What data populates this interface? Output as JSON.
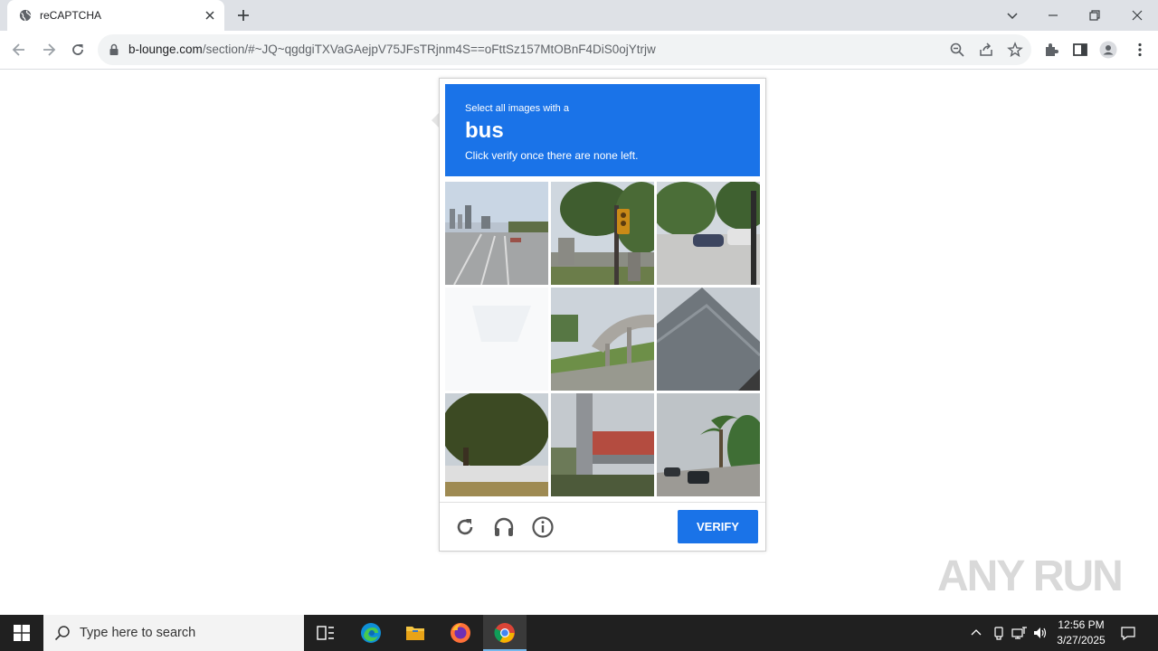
{
  "browser": {
    "tab_title": "reCAPTCHA",
    "url_host": "b-lounge.com",
    "url_path": "/section/#~JQ~qgdgiTXVaGAejpV75JFsTRjnm4S==oFttSz157MtOBnF4DiS0ojYtrjw"
  },
  "captcha": {
    "instruction_line1": "Select all images with a",
    "target": "bus",
    "instruction_line2": "Click verify once there are none left.",
    "verify_label": "VERIFY",
    "accent_color": "#1a73e8",
    "tiles": [
      {
        "name": "tile-highway-skyline",
        "scene": "road-skyline"
      },
      {
        "name": "tile-traffic-light",
        "scene": "traffic-light-trees"
      },
      {
        "name": "tile-parked-cars",
        "scene": "cars-trees"
      },
      {
        "name": "tile-faded-blank",
        "scene": "blank"
      },
      {
        "name": "tile-overpass",
        "scene": "overpass"
      },
      {
        "name": "tile-stadium-roof",
        "scene": "roof"
      },
      {
        "name": "tile-tree",
        "scene": "tree"
      },
      {
        "name": "tile-bridge-pillar",
        "scene": "bridge"
      },
      {
        "name": "tile-palm-street",
        "scene": "palm-street"
      }
    ]
  },
  "watermark": "ANY RUN",
  "taskbar": {
    "search_placeholder": "Type here to search",
    "time": "12:56 PM",
    "date": "3/27/2025"
  }
}
